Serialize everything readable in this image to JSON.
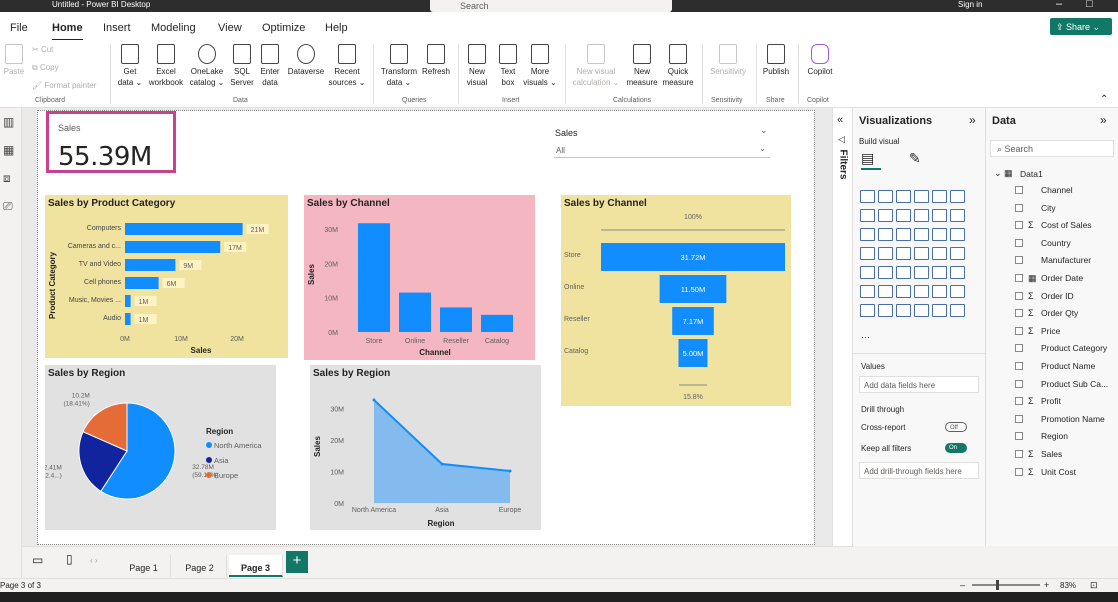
{
  "window": {
    "title": "Untitled - Power BI Desktop",
    "search_placeholder": "Search",
    "sign_in": "Sign in"
  },
  "menu": [
    "File",
    "Home",
    "Insert",
    "Modeling",
    "View",
    "Optimize",
    "Help"
  ],
  "menu_active": "Home",
  "share_label": "Share",
  "ribbon": {
    "clipboard": {
      "paste": "Paste",
      "cut": "Cut",
      "copy": "Copy",
      "format_painter": "Format painter",
      "group": "Clipboard"
    },
    "data": {
      "items": [
        {
          "l1": "Get",
          "l2": "data ⌄",
          "icon": "database-icon"
        },
        {
          "l1": "Excel",
          "l2": "workbook",
          "icon": "excel-icon"
        },
        {
          "l1": "OneLake",
          "l2": "catalog ⌄",
          "icon": "onelake-icon"
        },
        {
          "l1": "SQL",
          "l2": "Server",
          "icon": "sql-server-icon"
        },
        {
          "l1": "Enter",
          "l2": "data",
          "icon": "table-icon"
        },
        {
          "l1": "Dataverse",
          "l2": "",
          "icon": "dataverse-icon"
        },
        {
          "l1": "Recent",
          "l2": "sources ⌄",
          "icon": "recent-sources-icon"
        }
      ],
      "group": "Data"
    },
    "queries": {
      "transform": {
        "l1": "Transform",
        "l2": "data ⌄"
      },
      "refresh": "Refresh",
      "group": "Queries"
    },
    "insert": {
      "items": [
        {
          "l1": "New",
          "l2": "visual"
        },
        {
          "l1": "Text",
          "l2": "box"
        },
        {
          "l1": "More",
          "l2": "visuals ⌄"
        }
      ],
      "group": "Insert"
    },
    "calculations": {
      "items": [
        {
          "l1": "New visual",
          "l2": "calculation ⌄",
          "disabled": true
        },
        {
          "l1": "New",
          "l2": "measure",
          "disabled": false
        },
        {
          "l1": "Quick",
          "l2": "measure",
          "disabled": false
        }
      ],
      "group": "Calculations"
    },
    "sensitivity": {
      "label": "Sensitivity",
      "group": "Sensitivity"
    },
    "share": {
      "label": "Publish",
      "group": "Share"
    },
    "copilot": {
      "label": "Copilot",
      "group": "Copilot"
    }
  },
  "card": {
    "label": "Sales",
    "value": "55.39M"
  },
  "slicer": {
    "title": "Sales",
    "value": "All"
  },
  "visuals": {
    "bar_title": "Sales by Product Category",
    "column_title": "Sales by Channel",
    "funnel_title": "Sales by Channel",
    "pie_title": "Sales by Region",
    "area_title": "Sales by Region"
  },
  "chart_data": [
    {
      "type": "bar",
      "title": "Sales by Product Category",
      "xlabel": "Sales",
      "ylabel": "Product Category",
      "categories": [
        "Computers",
        "Cameras and c...",
        "TV and Video",
        "Cell phones",
        "Music, Movies ...",
        "Audio"
      ],
      "values": [
        21,
        17,
        9,
        6,
        1,
        1
      ],
      "data_labels": [
        "21M",
        "17M",
        "9M",
        "6M",
        "1M",
        "1M"
      ],
      "xticks": [
        "0M",
        "10M",
        "20M"
      ],
      "xlim": [
        0,
        25
      ],
      "unit": "M",
      "color": "#118dff",
      "background": "#f0e3a0"
    },
    {
      "type": "bar",
      "title": "Sales by Channel",
      "xlabel": "Channel",
      "ylabel": "Sales",
      "categories": [
        "Store",
        "Online",
        "Reseller",
        "Catalog"
      ],
      "values": [
        31.72,
        11.5,
        7.17,
        5.0
      ],
      "yticks": [
        "0M",
        "10M",
        "20M",
        "30M"
      ],
      "ylim": [
        0,
        35
      ],
      "unit": "M",
      "color": "#118dff",
      "background": "#f4b6c0"
    },
    {
      "type": "bar",
      "subtype": "funnel",
      "title": "Sales by Channel",
      "categories": [
        "Store",
        "Online",
        "Reseller",
        "Catalog"
      ],
      "values": [
        31.72,
        11.5,
        7.17,
        5.0
      ],
      "data_labels": [
        "31.72M",
        "11.50M",
        "7.17M",
        "5.00M"
      ],
      "top_label": "100%",
      "bottom_label": "15.8%",
      "color": "#118dff",
      "background": "#f0e3a0"
    },
    {
      "type": "pie",
      "title": "Sales by Region",
      "legend_title": "Region",
      "legend_position": "right",
      "labels": [
        "North America",
        "Asia",
        "Europe"
      ],
      "values": [
        32.78,
        12.41,
        10.2
      ],
      "data_labels": [
        [
          "32.78M",
          "(59.18%)"
        ],
        [
          "12.41M",
          "(22.4...)"
        ],
        [
          "10.2M",
          "(18.41%)"
        ]
      ],
      "colors": [
        "#118dff",
        "#12239e",
        "#e66c37"
      ],
      "background": "#e1e1e1"
    },
    {
      "type": "area",
      "title": "Sales by Region",
      "xlabel": "Region",
      "ylabel": "Sales",
      "categories": [
        "North America",
        "Asia",
        "Europe"
      ],
      "values": [
        32.78,
        12.41,
        10.2
      ],
      "yticks": [
        "0M",
        "10M",
        "20M",
        "30M"
      ],
      "ylim": [
        0,
        35
      ],
      "color": "#118dff",
      "background": "#e1e1e1"
    }
  ],
  "pages": [
    "Page 1",
    "Page 2",
    "Page 3"
  ],
  "active_page": "Page 3",
  "status": {
    "page": "Page 3 of 3",
    "zoom": "83%"
  },
  "visualizations_pane": {
    "title": "Visualizations",
    "build_visual": "Build visual",
    "values_label": "Values",
    "values_placeholder": "Add data fields here",
    "drill_through": "Drill through",
    "cross_report": "Cross-report",
    "cross_report_state": "Off",
    "keep_all_filters": "Keep all filters",
    "keep_all_filters_state": "On",
    "drill_placeholder": "Add drill-through fields here"
  },
  "filters_label": "Filters",
  "data_pane": {
    "title": "Data",
    "search_placeholder": "Search",
    "table": "Data1",
    "fields": [
      {
        "name": "Channel",
        "sigma": false
      },
      {
        "name": "City",
        "sigma": false
      },
      {
        "name": "Cost of Sales",
        "sigma": true
      },
      {
        "name": "Country",
        "sigma": false
      },
      {
        "name": "Manufacturer",
        "sigma": false
      },
      {
        "name": "Order Date",
        "sigma": false,
        "date": true
      },
      {
        "name": "Order ID",
        "sigma": true
      },
      {
        "name": "Order Qty",
        "sigma": true
      },
      {
        "name": "Price",
        "sigma": true
      },
      {
        "name": "Product Category",
        "sigma": false
      },
      {
        "name": "Product Name",
        "sigma": false
      },
      {
        "name": "Product Sub Ca...",
        "sigma": false
      },
      {
        "name": "Profit",
        "sigma": true
      },
      {
        "name": "Promotion Name",
        "sigma": false
      },
      {
        "name": "Region",
        "sigma": false
      },
      {
        "name": "Sales",
        "sigma": true
      },
      {
        "name": "Unit Cost",
        "sigma": true
      }
    ]
  }
}
